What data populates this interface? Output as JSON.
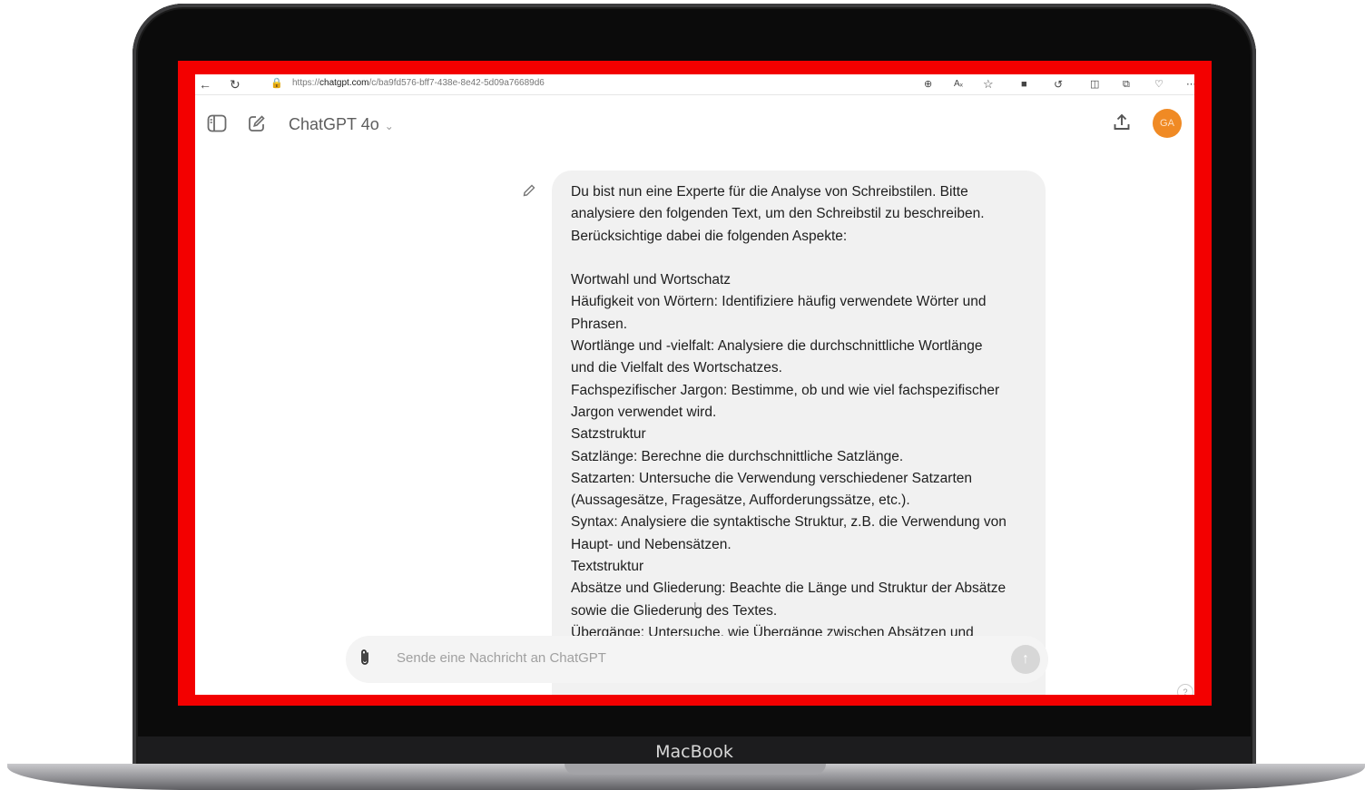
{
  "device": {
    "label": "MacBook"
  },
  "browser": {
    "url_prefix": "https://",
    "url_host": "chatgpt.com",
    "url_path": "/c/ba9fd576-bff7-438e-8e42-5d09a76689d6"
  },
  "header": {
    "model_name": "ChatGPT 4o",
    "avatar_initials": "GA"
  },
  "message": {
    "lines": [
      "Du bist nun eine Experte für die Analyse von Schreibstilen. Bitte",
      "analysiere den folgenden Text, um den Schreibstil zu beschreiben.",
      "Berücksichtige dabei die folgenden Aspekte:",
      "",
      "Wortwahl und Wortschatz",
      "Häufigkeit von Wörtern: Identifiziere häufig verwendete Wörter und",
      "Phrasen.",
      "Wortlänge und -vielfalt: Analysiere die durchschnittliche Wortlänge",
      "und die Vielfalt des Wortschatzes.",
      "Fachspezifischer Jargon: Bestimme, ob und wie viel fachspezifischer",
      "Jargon verwendet wird.",
      "Satzstruktur",
      "Satzlänge: Berechne die durchschnittliche Satzlänge.",
      "Satzarten: Untersuche die Verwendung verschiedener Satzarten",
      "(Aussagesätze, Fragesätze, Aufforderungssätze, etc.).",
      "Syntax: Analysiere die syntaktische Struktur, z.B. die Verwendung von",
      "Haupt- und Nebensätzen.",
      "Textstruktur",
      "Absätze und Gliederung: Beachte die Länge und Struktur der Absätze",
      "sowie die Gliederung des Textes.",
      "Übergänge: Untersuche, wie Übergänge zwischen Absätzen und"
    ]
  },
  "composer": {
    "placeholder": "Sende eine Nachricht an ChatGPT"
  },
  "help": {
    "label": "?"
  }
}
